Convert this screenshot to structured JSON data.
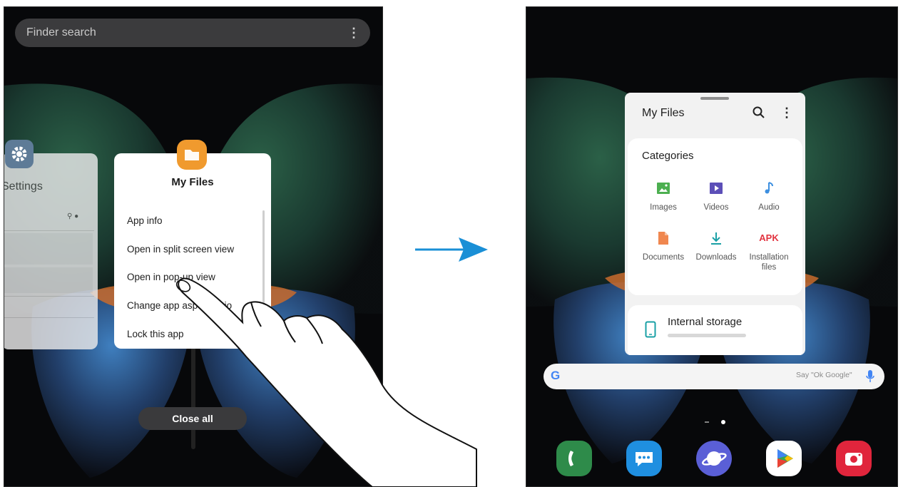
{
  "left_screen": {
    "finder": {
      "placeholder": "Finder search",
      "menu_icon": "more-vertical-icon"
    },
    "settings_card": {
      "title": "Settings",
      "icon": "gear-icon"
    },
    "app_card": {
      "name": "My Files",
      "icon": "folder-icon",
      "menu": [
        "App info",
        "Open in split screen view",
        "Open in pop-up view",
        "Change app aspect ratio",
        "Lock this app"
      ]
    },
    "close_all_label": "Close all"
  },
  "transition_arrow_color": "#1a8fd6",
  "right_screen": {
    "popup": {
      "title": "My Files",
      "categories_title": "Categories",
      "categories": [
        {
          "label": "Images",
          "icon": "image-icon",
          "color": "#4caf50"
        },
        {
          "label": "Videos",
          "icon": "video-icon",
          "color": "#5c4fb8"
        },
        {
          "label": "Audio",
          "icon": "music-note-icon",
          "color": "#3d8fe0"
        },
        {
          "label": "Documents",
          "icon": "document-icon",
          "color": "#f0874f"
        },
        {
          "label": "Downloads",
          "icon": "download-icon",
          "color": "#1aa0a6"
        },
        {
          "label": "Installation files",
          "icon": "apk-icon",
          "color": "#e2333f",
          "badge": "APK"
        }
      ],
      "storage_title": "Internal storage"
    },
    "google_bar": {
      "logo": "G",
      "hint": "Say \"Ok Google\"",
      "mic_icon": "mic-icon"
    },
    "dock": [
      {
        "name": "phone",
        "icon": "phone-icon",
        "color": "#2e8b4a"
      },
      {
        "name": "messages",
        "icon": "chat-icon",
        "color": "#1f8fe0"
      },
      {
        "name": "internet",
        "icon": "planet-icon",
        "color": "#5a5fd6"
      },
      {
        "name": "play-store",
        "icon": "play-store-icon",
        "color": "#ffffff"
      },
      {
        "name": "camera",
        "icon": "camera-icon",
        "color": "#e0253c"
      }
    ]
  }
}
